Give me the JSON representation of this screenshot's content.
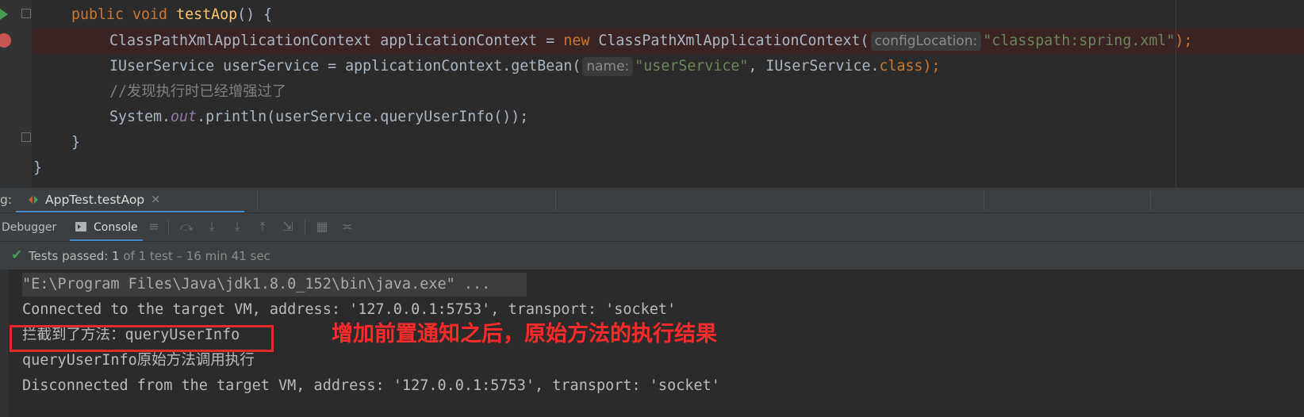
{
  "editor": {
    "line1": {
      "kw": "public void ",
      "fn": "testAop",
      "rest": "() {"
    },
    "line2": {
      "a": "ClassPathXmlApplicationContext applicationContext = ",
      "kw_new": "new",
      "b": " ClassPathXmlApplicationContext(",
      "hint": "configLocation:",
      "str": "\"classpath:spring.xml\"",
      "end": ");"
    },
    "line3": {
      "a": "IUserService userService = applicationContext.getBean(",
      "hint": "name:",
      "str": "\"userService\"",
      "b": ", IUserService.",
      "kw_class": "class",
      "end": ");"
    },
    "line4": {
      "comment": "//发现执行时已经增强过了"
    },
    "line5": {
      "a": "System.",
      "ital": "out",
      "b": ".println(userService.queryUserInfo());"
    },
    "line6": {
      "text": "}"
    },
    "line7": {
      "text": "}"
    }
  },
  "debug_tabbar": {
    "prefix": "g:",
    "tab_title": "AppTest.testAop",
    "close": "×"
  },
  "subtoolbar": {
    "debugger_label": "Debugger",
    "console_label": "Console"
  },
  "status": {
    "passed": "Tests passed: 1",
    "detail": " of 1 test – 16 min 41 sec"
  },
  "console": {
    "line1": "\"E:\\Program Files\\Java\\jdk1.8.0_152\\bin\\java.exe\" ...",
    "line2": "Connected to the target VM, address: '127.0.0.1:5753', transport: 'socket'",
    "line3_cjk": "拦截到了方法：",
    "line3_rest": "queryUserInfo",
    "line4_a": "queryUserInfo",
    "line4_cjk": "原始方法调用执行",
    "line5": "Disconnected from the target VM, address: '127.0.0.1:5753', transport: 'socket'"
  },
  "annotation": "增加前置通知之后，原始方法的执行结果",
  "colors": {
    "keyword": "#cc7832",
    "function": "#ffc66d",
    "string": "#6a8759",
    "comment": "#808080",
    "annotation_red": "#ff2a2a",
    "pass_green": "#499c54",
    "accent_blue": "#4a88c7"
  }
}
